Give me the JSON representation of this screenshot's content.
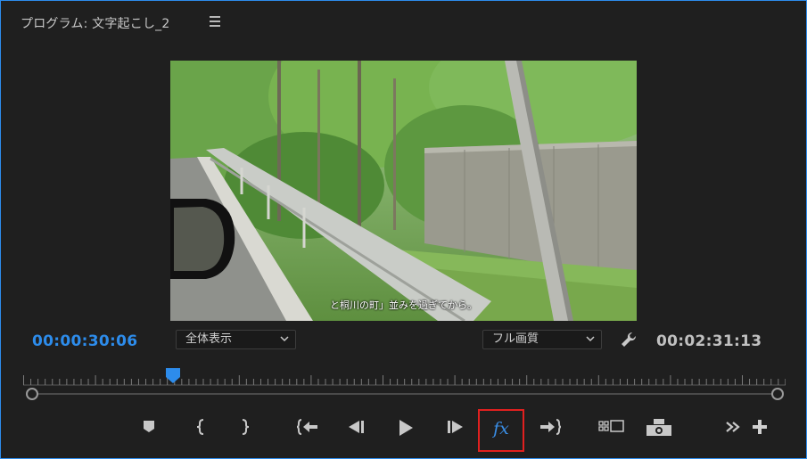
{
  "panel": {
    "title": "プログラム: 文字起こし_2",
    "accent_color": "#2d8ceb",
    "highlight_color": "#e1201f"
  },
  "video": {
    "subtitle": "と桐川の町」並みを過ぎてから。"
  },
  "timecodes": {
    "current": "00:00:30:06",
    "duration": "00:02:31:13"
  },
  "zoom_select": {
    "value": "全体表示"
  },
  "quality_select": {
    "value": "フル画質"
  },
  "playhead": {
    "position_fraction": 0.199
  },
  "controls": [
    {
      "icon": "add-marker-icon"
    },
    {
      "icon": "mark-in-icon"
    },
    {
      "icon": "mark-out-icon"
    },
    {
      "icon": "go-to-in-icon"
    },
    {
      "icon": "step-back-icon"
    },
    {
      "icon": "play-icon"
    },
    {
      "icon": "step-forward-icon"
    },
    {
      "icon": "fx-icon",
      "label": "fx"
    },
    {
      "icon": "go-to-out-icon"
    },
    {
      "icon": "compare-view-icon"
    },
    {
      "icon": "export-frame-icon"
    },
    {
      "icon": "more-icon"
    },
    {
      "icon": "add-button-icon"
    }
  ]
}
